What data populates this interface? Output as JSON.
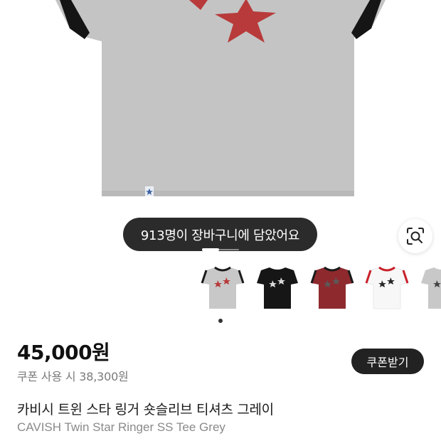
{
  "toast": {
    "text": "913명이 장바구니에 담았어요"
  },
  "gallery": {
    "current_slide": 1,
    "lens_button": {
      "icon": "lens-search-icon"
    },
    "thumbnails": [
      {
        "name": "grey",
        "body_color": "#c8c8c8",
        "trim_color": "#1a1a1a",
        "star_colors": [
          "#b83a3a",
          "#b83a3a"
        ]
      },
      {
        "name": "black",
        "body_color": "#161616",
        "trim_color": "#161616",
        "star_colors": [
          "#d9d9d9",
          "#d9d9d9"
        ]
      },
      {
        "name": "burgundy",
        "body_color": "#8e2a2e",
        "trim_color": "#1a1a1a",
        "star_colors": [
          "#5a5a5a",
          "#5a5a5a"
        ]
      },
      {
        "name": "white",
        "body_color": "#f7f7f7",
        "trim_color": "#c8202a",
        "star_colors": [
          "#2a2a2a",
          "#2a2a2a"
        ]
      },
      {
        "name": "grey-partial",
        "body_color": "#c8c8c8",
        "trim_color": "#c8c8c8",
        "star_colors": [
          "#444444",
          "#444444"
        ]
      }
    ]
  },
  "product": {
    "price": "45,000원",
    "coupon_price": "쿠폰 사용 시 38,300원",
    "coupon_button": "쿠폰받기",
    "name_ko": "카비시 트윈 스타 링거 숏슬리브 티셔츠 그레이",
    "name_en": "CAVISH Twin Star Ringer SS Tee Grey"
  },
  "colors": {
    "tee_grey": "#c4c4c4",
    "star_red": "#b83a3a",
    "toast_bg": "#2b2b2b",
    "button_bg": "#222222"
  }
}
